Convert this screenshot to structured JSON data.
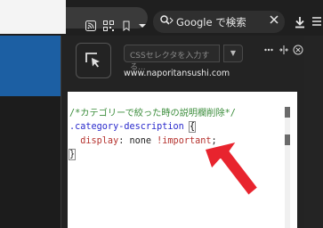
{
  "search": {
    "label": "Google で検索"
  },
  "panel": {
    "css_input_placeholder": "CSSセレクタを入力する...",
    "site": "www.naporitansushi.com"
  },
  "editor": {
    "line1": "/*カテゴリーで絞った時の説明欄削除*/",
    "line2_selector": ".category-description ",
    "line2_brace": "{",
    "line3_prop": "  display",
    "line3_colon": ": ",
    "line3_value": "none ",
    "line3_important": "!important",
    "line3_semi": ";",
    "line4": "}"
  },
  "colors": {
    "accent_arrow": "#e8242e",
    "page_blue": "#1c5fa3"
  },
  "icons": [
    "rss-icon",
    "qr-code-icon",
    "bookmark-icon",
    "dropdown-arrow-icon",
    "search-icon",
    "clear-icon",
    "download-icon",
    "menu-icon",
    "element-picker-icon",
    "more-icon",
    "dock-icon",
    "close-icon"
  ]
}
